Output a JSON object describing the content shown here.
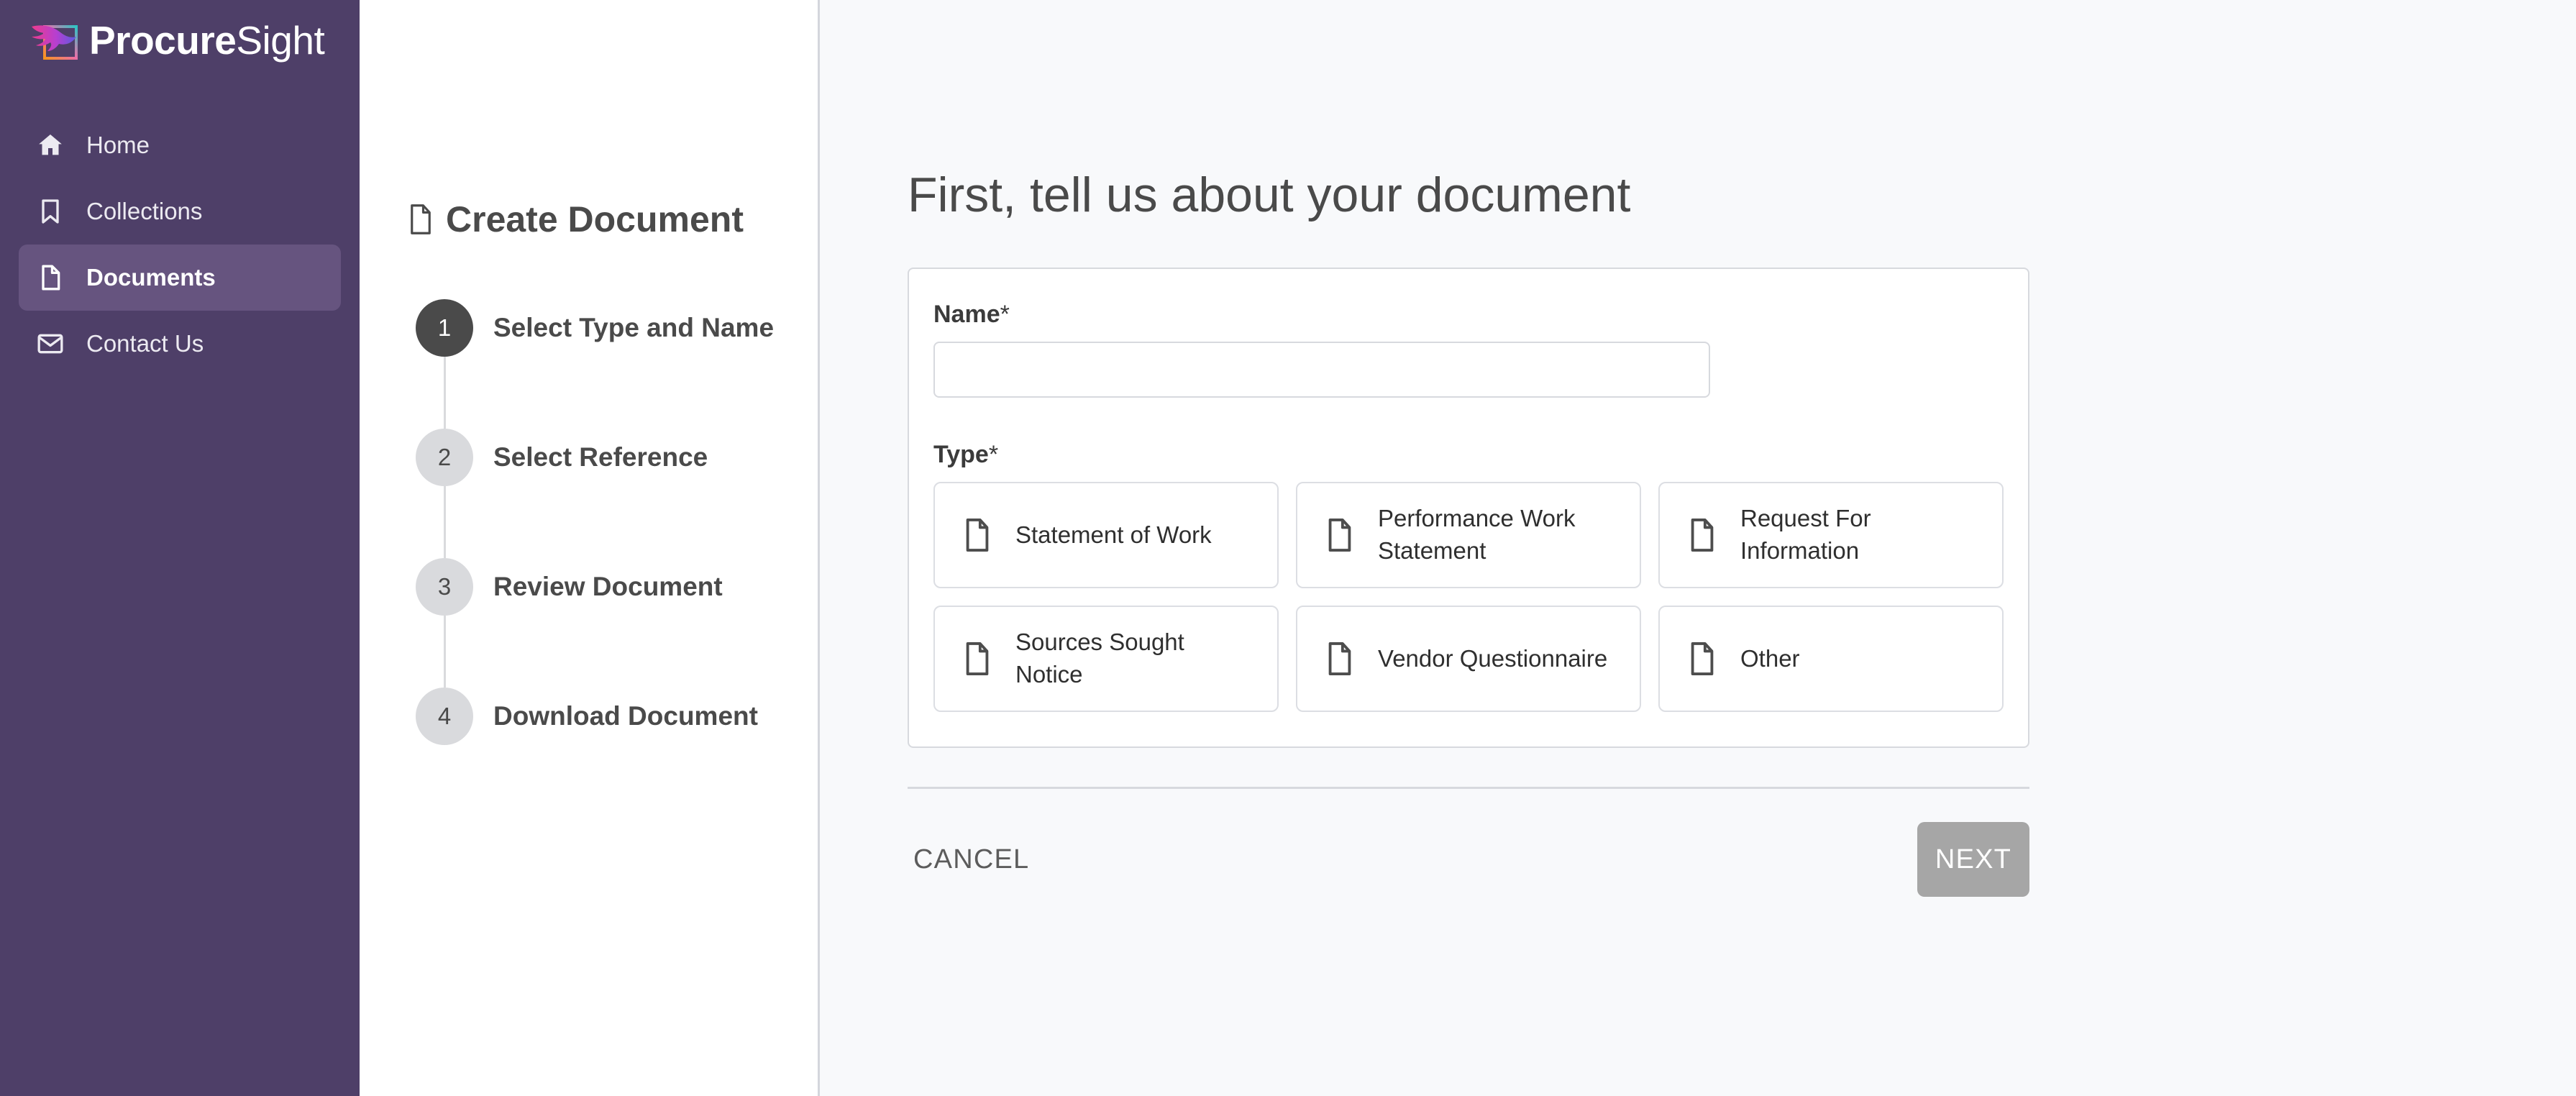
{
  "brand": {
    "name_bold": "Procure",
    "name_light": "Sight",
    "logo_icon": "procuresight-bird-logo",
    "apps_icon": "apps-grid-icon"
  },
  "sidebar": {
    "items": [
      {
        "label": "Home",
        "icon": "home-icon",
        "active": false
      },
      {
        "label": "Collections",
        "icon": "bookmark-icon",
        "active": false
      },
      {
        "label": "Documents",
        "icon": "document-icon",
        "active": true
      },
      {
        "label": "Contact Us",
        "icon": "envelope-icon",
        "active": false
      }
    ]
  },
  "stepper": {
    "title": "Create Document",
    "title_icon": "document-icon",
    "steps": [
      {
        "number": "1",
        "label": "Select Type and Name",
        "active": true
      },
      {
        "number": "2",
        "label": "Select Reference",
        "active": false
      },
      {
        "number": "3",
        "label": "Review Document",
        "active": false
      },
      {
        "number": "4",
        "label": "Download Document",
        "active": false
      }
    ]
  },
  "main": {
    "heading": "First, tell us about your document",
    "name_field": {
      "label": "Name",
      "required_marker": "*",
      "value": "",
      "placeholder": ""
    },
    "type_field": {
      "label": "Type",
      "required_marker": "*",
      "options": [
        {
          "label": "Statement of Work",
          "icon": "document-icon",
          "selected": false
        },
        {
          "label": "Performance Work Statement",
          "icon": "document-icon",
          "selected": false
        },
        {
          "label": "Request For Information",
          "icon": "document-icon",
          "selected": false
        },
        {
          "label": "Sources Sought Notice",
          "icon": "document-icon",
          "selected": false
        },
        {
          "label": "Vendor Questionnaire",
          "icon": "document-icon",
          "selected": false
        },
        {
          "label": "Other",
          "icon": "document-icon",
          "selected": false
        }
      ]
    },
    "footer": {
      "cancel_label": "CANCEL",
      "next_label": "NEXT",
      "next_disabled": true
    }
  },
  "colors": {
    "sidebar_bg": "#4e3f68",
    "sidebar_active_bg": "#66547f",
    "main_bg": "#f8f9fb",
    "card_bg": "#ffffff",
    "border": "#d7d9de",
    "text_dark": "#4a4a4a",
    "step_inactive": "#d9dadd",
    "step_active": "#4a4a4a",
    "next_disabled_bg": "#a6a6a6"
  }
}
